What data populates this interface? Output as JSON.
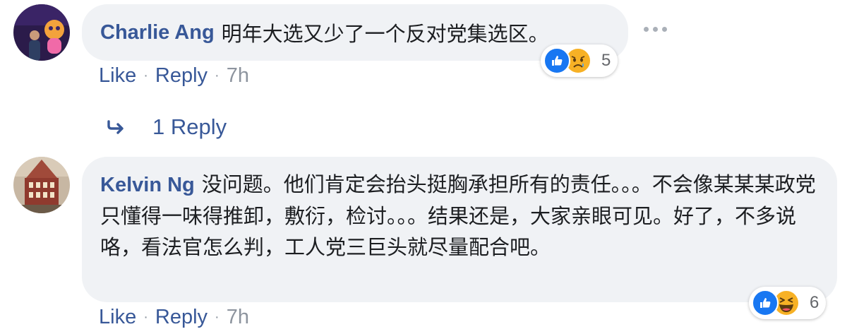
{
  "comments": [
    {
      "author": "Charlie Ang",
      "text": "明年大选又少了一个反对党集选区。",
      "reaction_count": "5",
      "reactions": [
        "like-icon",
        "sad-icon"
      ],
      "actions": {
        "like": "Like",
        "reply": "Reply",
        "time": "7h"
      },
      "replies_link": "1 Reply"
    },
    {
      "author": "Kelvin Ng",
      "text": "没问题。他们肯定会抬头挺胸承担所有的责任。。。不会像某某某政党只懂得一味得推卸，敷衍，检讨。。。结果还是，大家亲眼可见。好了，不多说咯，看法官怎么判，工人党三巨头就尽量配合吧。",
      "reaction_count": "6",
      "reactions": [
        "like-icon",
        "haha-icon"
      ],
      "actions": {
        "like": "Like",
        "reply": "Reply",
        "time": "7h"
      }
    }
  ],
  "separator": "·",
  "colors": {
    "link": "#385898",
    "bubble": "#f0f2f5",
    "meta": "#8d949e",
    "like": "#1877f2",
    "emoji": "#f7b125"
  }
}
